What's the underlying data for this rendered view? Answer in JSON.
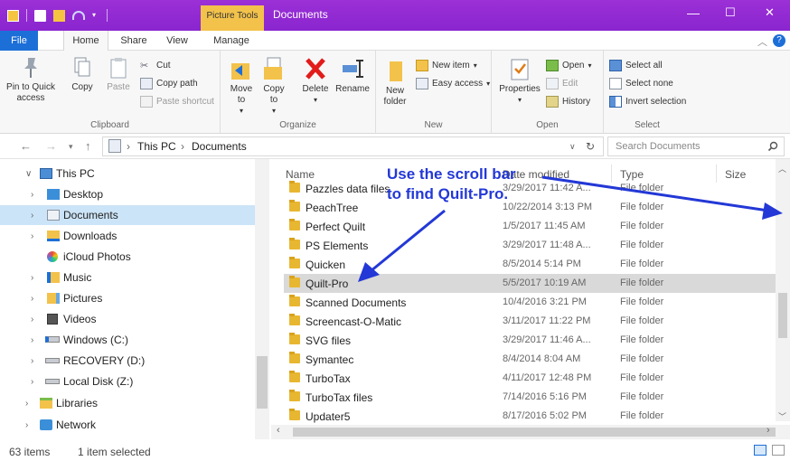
{
  "title_bar": {
    "context_tab": "Picture Tools",
    "window_title": "Documents",
    "minimize": "—",
    "maximize": "☐",
    "close": "✕"
  },
  "ribbon_tabs": {
    "file": "File",
    "home": "Home",
    "share": "Share",
    "view": "View",
    "manage": "Manage"
  },
  "ribbon": {
    "clipboard": {
      "label": "Clipboard",
      "pin_to_quick_access": "Pin to Quick access",
      "copy": "Copy",
      "paste": "Paste",
      "cut": "Cut",
      "copy_path": "Copy path",
      "paste_shortcut": "Paste shortcut"
    },
    "organize": {
      "label": "Organize",
      "move_to": "Move to",
      "copy_to": "Copy to",
      "delete": "Delete",
      "rename": "Rename"
    },
    "new": {
      "label": "New",
      "new_folder": "New folder",
      "new_item": "New item",
      "easy_access": "Easy access"
    },
    "open": {
      "label": "Open",
      "properties": "Properties",
      "open": "Open",
      "edit": "Edit",
      "history": "History"
    },
    "select": {
      "label": "Select",
      "select_all": "Select all",
      "select_none": "Select none",
      "invert_selection": "Invert selection"
    }
  },
  "address": {
    "path": [
      "This PC",
      "Documents"
    ],
    "search_placeholder": "Search Documents"
  },
  "nav_pane": {
    "items": [
      {
        "label": "This PC",
        "icon": "computer-icon"
      },
      {
        "label": "Desktop",
        "icon": "desktop-folder-icon"
      },
      {
        "label": "Documents",
        "icon": "documents-folder-icon"
      },
      {
        "label": "Downloads",
        "icon": "downloads-folder-icon"
      },
      {
        "label": "iCloud Photos",
        "icon": "icloud-photos-icon"
      },
      {
        "label": "Music",
        "icon": "music-folder-icon"
      },
      {
        "label": "Pictures",
        "icon": "pictures-folder-icon"
      },
      {
        "label": "Videos",
        "icon": "videos-folder-icon"
      },
      {
        "label": "Windows (C:)",
        "icon": "drive-icon"
      },
      {
        "label": "RECOVERY (D:)",
        "icon": "drive-icon"
      },
      {
        "label": "Local Disk (Z:)",
        "icon": "drive-icon"
      },
      {
        "label": "Libraries",
        "icon": "libraries-icon"
      },
      {
        "label": "Network",
        "icon": "network-icon"
      }
    ]
  },
  "file_list": {
    "columns": {
      "name": "Name",
      "date_modified": "Date modified",
      "type": "Type",
      "size": "Size"
    },
    "rows": [
      {
        "name": "Pazzles data files",
        "date": "3/29/2017 11:42 A...",
        "type": "File folder"
      },
      {
        "name": "PeachTree",
        "date": "10/22/2014 3:13 PM",
        "type": "File folder"
      },
      {
        "name": "Perfect Quilt",
        "date": "1/5/2017 11:45 AM",
        "type": "File folder"
      },
      {
        "name": "PS Elements",
        "date": "3/29/2017 11:48 A...",
        "type": "File folder"
      },
      {
        "name": "Quicken",
        "date": "8/5/2014 5:14 PM",
        "type": "File folder"
      },
      {
        "name": "Quilt-Pro",
        "date": "5/5/2017 10:19 AM",
        "type": "File folder"
      },
      {
        "name": "Scanned Documents",
        "date": "10/4/2016 3:21 PM",
        "type": "File folder"
      },
      {
        "name": "Screencast-O-Matic",
        "date": "3/11/2017 11:22 PM",
        "type": "File folder"
      },
      {
        "name": "SVG files",
        "date": "3/29/2017 11:46 A...",
        "type": "File folder"
      },
      {
        "name": "Symantec",
        "date": "8/4/2014 8:04 AM",
        "type": "File folder"
      },
      {
        "name": "TurboTax",
        "date": "4/11/2017 12:48 PM",
        "type": "File folder"
      },
      {
        "name": "TurboTax files",
        "date": "7/14/2016 5:16 PM",
        "type": "File folder"
      },
      {
        "name": "Updater5",
        "date": "8/17/2016 5:02 PM",
        "type": "File folder"
      }
    ]
  },
  "annotation": {
    "line1": "Use the scroll bar",
    "line2": "to find Quilt-Pro."
  },
  "status_bar": {
    "item_count": "63 items",
    "selection": "1 item selected"
  },
  "colors": {
    "title_bar": "#8a25cf",
    "file_tab": "#1d6fd8",
    "context_tab": "#f3c24b",
    "annotation": "#2338d6",
    "selected_nav": "#cce4f7",
    "selected_row": "#d9d9d9",
    "folder": "#e8b731"
  }
}
